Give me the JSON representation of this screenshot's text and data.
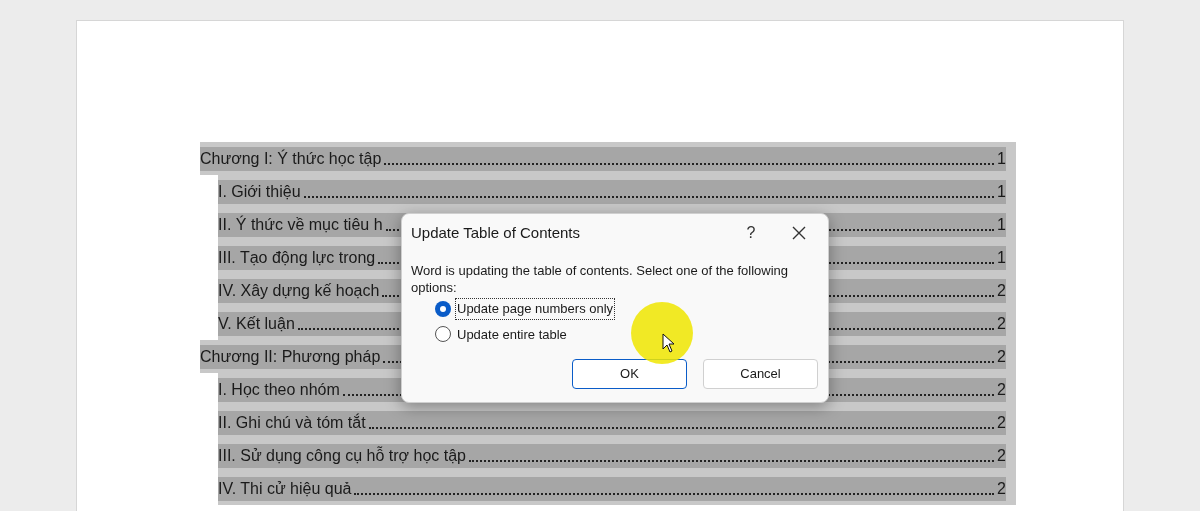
{
  "toc": [
    {
      "text": "Chương I: Ý thức học tập",
      "page": "1",
      "children": [
        {
          "text": "I. Giới thiệu",
          "page": "1"
        },
        {
          "text": "II. Ý thức về mục tiêu h",
          "page": "1"
        },
        {
          "text": "III. Tạo động lực trong",
          "page": "1"
        },
        {
          "text": "IV. Xây dựng kế hoạch",
          "page": "2"
        },
        {
          "text": "V. Kết luận",
          "page": "2"
        }
      ]
    },
    {
      "text": "Chương II: Phương pháp",
      "page": "2",
      "children": [
        {
          "text": "I. Học theo nhóm",
          "page": "2"
        },
        {
          "text": "II. Ghi chú và tóm tắt",
          "page": "2"
        },
        {
          "text": "III. Sử dụng công cụ hỗ trợ học tập",
          "page": "2"
        },
        {
          "text": "IV. Thi cử hiệu quả",
          "page": "2"
        }
      ]
    }
  ],
  "dialog": {
    "title": "Update Table of Contents",
    "help": "?",
    "message": "Word is updating the table of contents.  Select one of the following options:",
    "options": [
      {
        "label": "Update page numbers only",
        "selected": true
      },
      {
        "label": "Update entire table",
        "selected": false
      }
    ],
    "buttons": [
      {
        "label": "OK",
        "kind": "default"
      },
      {
        "label": "Cancel",
        "kind": "normal"
      }
    ]
  }
}
